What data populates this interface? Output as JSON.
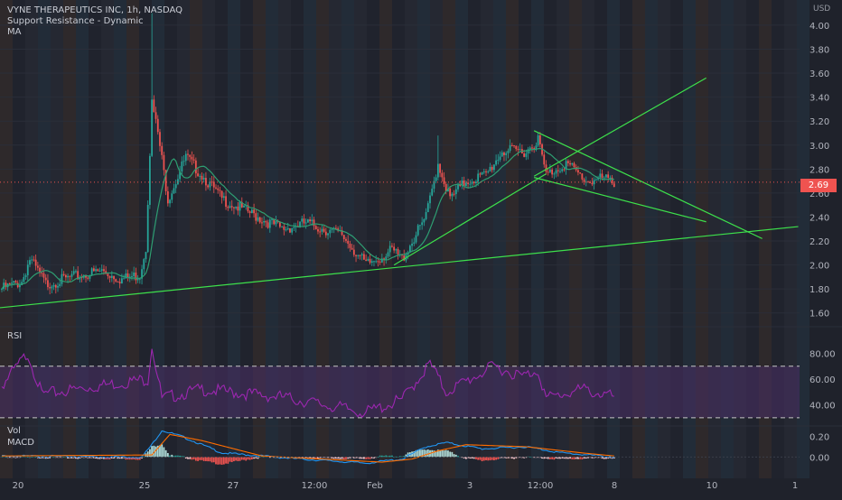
{
  "header": {
    "title": "VYNE THERAPEUTICS INC, 1h, NASDAQ",
    "indicator_1": "Support Resistance - Dynamic",
    "indicator_2": "MA",
    "currency": "USD",
    "last_price_label": "2.69"
  },
  "panes": {
    "rsi_label": "RSI",
    "vol_label": "Vol",
    "macd_label": "MACD"
  },
  "colors": {
    "background": "#1f222b",
    "up": "#26a69a",
    "down": "#ef5350",
    "trendline": "#3de04b",
    "ma": "#2e9e72",
    "rsi": "#9c27b0",
    "rsi_band": "#4a2f66",
    "macd": "#2196f3",
    "signal": "#ff6d00",
    "badge": "#ef5350"
  },
  "chart_data": [
    {
      "type": "candlestick",
      "ylim": [
        1.5,
        4.15
      ],
      "y_ticks": [
        "4.00",
        "3.80",
        "3.60",
        "3.40",
        "3.20",
        "3.00",
        "2.80",
        "2.60",
        "2.40",
        "2.20",
        "2.00",
        "1.80",
        "1.60"
      ],
      "y_tick_values": [
        4.0,
        3.8,
        3.6,
        3.4,
        3.2,
        3.0,
        2.8,
        2.6,
        2.4,
        2.2,
        2.0,
        1.8,
        1.6
      ],
      "x_ticks": [
        "20",
        "25",
        "27",
        "12:00",
        "Feb",
        "3",
        "12:00",
        "8",
        "10",
        "1"
      ],
      "last_price": 2.69,
      "keypoints": [
        {
          "bar": 0,
          "price": 1.8
        },
        {
          "bar": 10,
          "price": 1.86
        },
        {
          "bar": 14,
          "price": 2.05
        },
        {
          "bar": 22,
          "price": 1.84
        },
        {
          "bar": 36,
          "price": 1.9
        },
        {
          "bar": 50,
          "price": 1.95
        },
        {
          "bar": 60,
          "price": 1.88
        },
        {
          "bar": 69,
          "price": 1.92
        },
        {
          "bar": 72,
          "price": 2.15
        },
        {
          "bar": 75,
          "price": 3.35
        },
        {
          "bar": 78,
          "price": 3.1
        },
        {
          "bar": 83,
          "price": 2.55
        },
        {
          "bar": 92,
          "price": 2.9
        },
        {
          "bar": 100,
          "price": 2.75
        },
        {
          "bar": 110,
          "price": 2.55
        },
        {
          "bar": 122,
          "price": 2.45
        },
        {
          "bar": 140,
          "price": 2.3
        },
        {
          "bar": 152,
          "price": 2.35
        },
        {
          "bar": 170,
          "price": 2.25
        },
        {
          "bar": 182,
          "price": 2.0
        },
        {
          "bar": 195,
          "price": 2.12
        },
        {
          "bar": 200,
          "price": 2.05
        },
        {
          "bar": 212,
          "price": 2.4
        },
        {
          "bar": 218,
          "price": 2.85
        },
        {
          "bar": 224,
          "price": 2.55
        },
        {
          "bar": 232,
          "price": 2.7
        },
        {
          "bar": 242,
          "price": 2.75
        },
        {
          "bar": 250,
          "price": 2.95
        },
        {
          "bar": 262,
          "price": 2.95
        },
        {
          "bar": 268,
          "price": 3.05
        },
        {
          "bar": 272,
          "price": 2.75
        },
        {
          "bar": 282,
          "price": 2.85
        },
        {
          "bar": 292,
          "price": 2.7
        },
        {
          "bar": 300,
          "price": 2.72
        },
        {
          "bar": 306,
          "price": 2.69
        }
      ],
      "spikes": [
        {
          "bar": 75,
          "high": 4.1
        },
        {
          "bar": 78,
          "high": 3.25
        },
        {
          "bar": 218,
          "high": 3.08
        }
      ],
      "trendlines": [
        {
          "from": {
            "bar": -3,
            "price": 1.64
          },
          "to": {
            "bar": 398,
            "price": 2.32
          }
        },
        {
          "from": {
            "bar": 196,
            "price": 2.0
          },
          "to": {
            "bar": 272,
            "price": 2.76
          }
        },
        {
          "from": {
            "bar": 266,
            "price": 2.74
          },
          "to": {
            "bar": 352,
            "price": 3.56
          }
        },
        {
          "from": {
            "bar": 266,
            "price": 3.12
          },
          "to": {
            "bar": 380,
            "price": 2.22
          }
        },
        {
          "from": {
            "bar": 266,
            "price": 2.73
          },
          "to": {
            "bar": 352,
            "price": 2.36
          }
        }
      ]
    },
    {
      "type": "line",
      "name": "RSI",
      "ylim": [
        25,
        95
      ],
      "y_ticks": [
        "80.00",
        "60.00",
        "40.00"
      ],
      "y_tick_values": [
        80,
        60,
        40
      ],
      "bands": [
        70,
        30
      ],
      "keypoints": [
        {
          "bar": 0,
          "value": 55
        },
        {
          "bar": 13,
          "value": 80
        },
        {
          "bar": 20,
          "value": 48
        },
        {
          "bar": 45,
          "value": 54
        },
        {
          "bar": 73,
          "value": 60
        },
        {
          "bar": 75,
          "value": 86
        },
        {
          "bar": 80,
          "value": 45
        },
        {
          "bar": 100,
          "value": 52
        },
        {
          "bar": 140,
          "value": 46
        },
        {
          "bar": 182,
          "value": 34
        },
        {
          "bar": 200,
          "value": 44
        },
        {
          "bar": 214,
          "value": 72
        },
        {
          "bar": 222,
          "value": 50
        },
        {
          "bar": 246,
          "value": 70
        },
        {
          "bar": 260,
          "value": 62
        },
        {
          "bar": 268,
          "value": 67
        },
        {
          "bar": 272,
          "value": 45
        },
        {
          "bar": 290,
          "value": 52
        },
        {
          "bar": 306,
          "value": 46
        }
      ]
    },
    {
      "type": "bar",
      "name": "MACD",
      "ylim": [
        -0.12,
        0.32
      ],
      "y_ticks": [
        "0.20",
        "0.00"
      ],
      "y_tick_values": [
        0.2,
        0.0
      ],
      "macd_keypoints": [
        {
          "bar": 0,
          "value": 0.01
        },
        {
          "bar": 70,
          "value": 0.0
        },
        {
          "bar": 75,
          "value": 0.12
        },
        {
          "bar": 80,
          "value": 0.26
        },
        {
          "bar": 90,
          "value": 0.2
        },
        {
          "bar": 110,
          "value": 0.04
        },
        {
          "bar": 150,
          "value": -0.02
        },
        {
          "bar": 182,
          "value": -0.06
        },
        {
          "bar": 200,
          "value": -0.02
        },
        {
          "bar": 212,
          "value": 0.1
        },
        {
          "bar": 222,
          "value": 0.14
        },
        {
          "bar": 240,
          "value": 0.08
        },
        {
          "bar": 262,
          "value": 0.1
        },
        {
          "bar": 280,
          "value": 0.04
        },
        {
          "bar": 306,
          "value": 0.0
        }
      ],
      "signal_keypoints": [
        {
          "bar": 0,
          "value": 0.01
        },
        {
          "bar": 75,
          "value": 0.02
        },
        {
          "bar": 84,
          "value": 0.22
        },
        {
          "bar": 100,
          "value": 0.16
        },
        {
          "bar": 130,
          "value": 0.01
        },
        {
          "bar": 190,
          "value": -0.05
        },
        {
          "bar": 205,
          "value": -0.02
        },
        {
          "bar": 218,
          "value": 0.06
        },
        {
          "bar": 232,
          "value": 0.12
        },
        {
          "bar": 262,
          "value": 0.1
        },
        {
          "bar": 290,
          "value": 0.04
        },
        {
          "bar": 306,
          "value": 0.01
        }
      ]
    }
  ]
}
